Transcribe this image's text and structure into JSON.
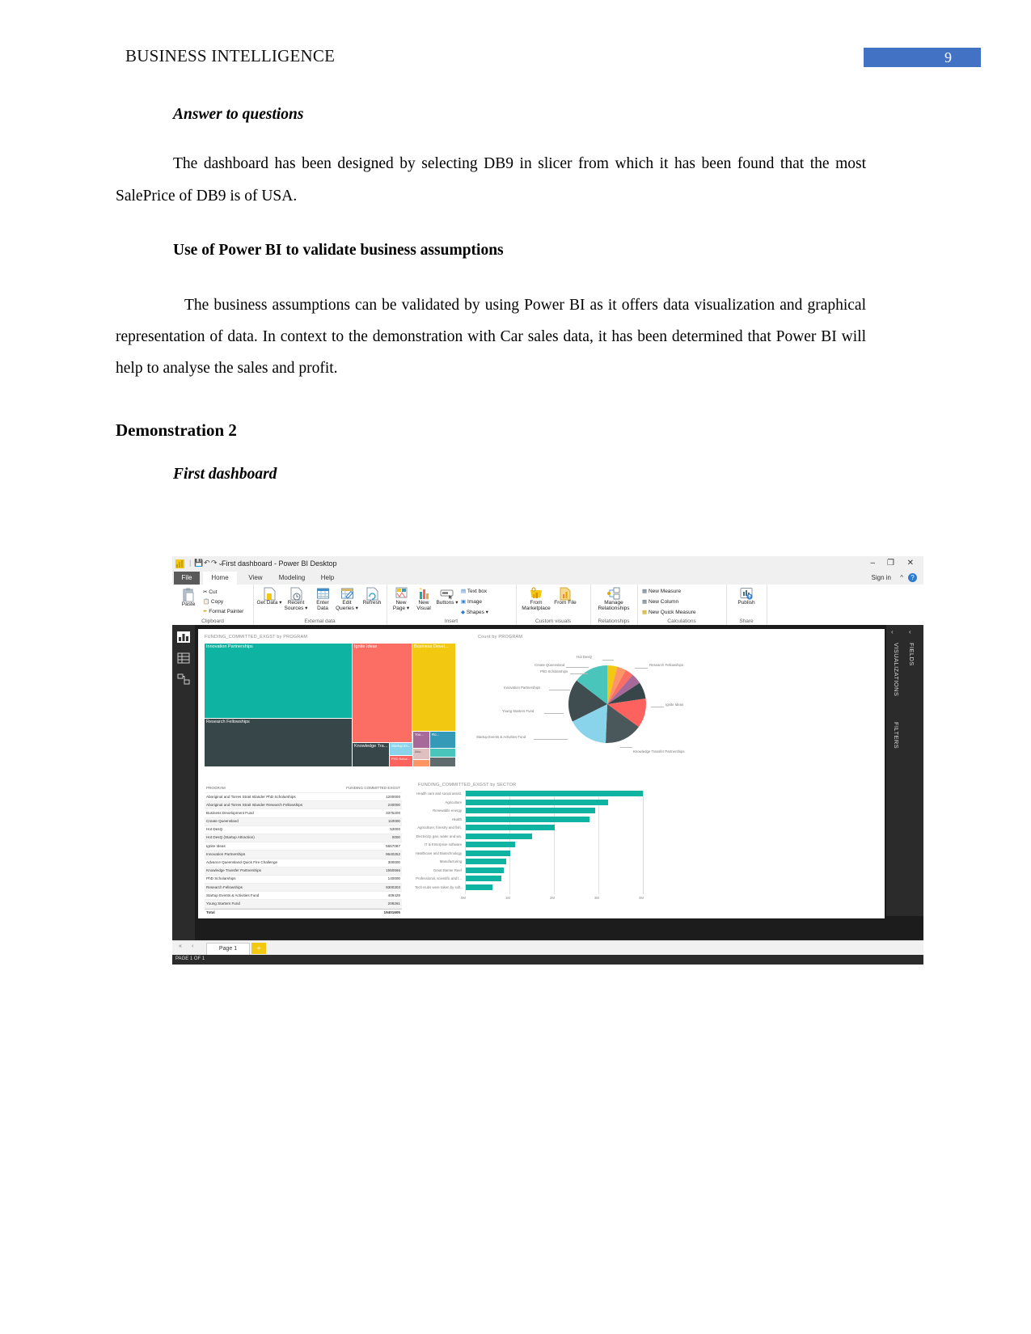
{
  "header": {
    "running_title": "BUSINESS INTELLIGENCE",
    "page_number": "9",
    "badge_color": "#4272c4"
  },
  "document": {
    "heading_answer": "Answer to questions",
    "para_1": "The dashboard has been designed by selecting DB9 in slicer from which it has been found that the most SalePrice of DB9 is of USA.",
    "heading_powerbi": "Use of Power BI to validate business assumptions",
    "para_2": "The business assumptions can be validated by using Power BI as it offers data visualization and graphical representation of data. In context to the demonstration with Car sales data, it has been determined that Power BI will help to analyse the sales and profit.",
    "heading_demo": "Demonstration 2",
    "heading_first_dashboard": "First dashboard"
  },
  "powerbi": {
    "title_bar": {
      "document_title": "First dashboard - Power BI Desktop",
      "qat": [
        "save-icon",
        "undo-icon",
        "redo-icon",
        "dropdown-icon"
      ],
      "window_buttons": [
        "minimize",
        "restore",
        "close"
      ],
      "minimize": "–",
      "restore": "❐",
      "close": "✕"
    },
    "ribbon_tabs": [
      {
        "label": "File",
        "active": false
      },
      {
        "label": "Home",
        "active": true
      },
      {
        "label": "View",
        "active": false
      },
      {
        "label": "Modeling",
        "active": false
      },
      {
        "label": "Help",
        "active": false
      }
    ],
    "sign_in": "Sign in",
    "help_badge": "?",
    "ribbon_groups": [
      {
        "name": "Clipboard",
        "items": [
          "Paste"
        ],
        "small_items": [
          "Cut",
          "Copy",
          "Format Painter"
        ]
      },
      {
        "name": "External data",
        "items": [
          "Get Data ▾",
          "Recent Sources ▾",
          "Enter Data",
          "Edit Queries ▾",
          "Refresh"
        ],
        "small_items": []
      },
      {
        "name": "Insert",
        "items": [
          "New Page ▾",
          "New Visual",
          "Buttons ▾"
        ],
        "small_items": [
          "Text box",
          "Image",
          "Shapes ▾"
        ]
      },
      {
        "name": "Custom visuals",
        "items": [
          "From Marketplace",
          "From File"
        ],
        "small_items": []
      },
      {
        "name": "Relationships",
        "items": [
          "Manage Relationships"
        ],
        "small_items": []
      },
      {
        "name": "Calculations",
        "items": [],
        "small_items": [
          "New Measure",
          "New Column",
          "New Quick Measure"
        ]
      },
      {
        "name": "Share",
        "items": [
          "Publish"
        ],
        "small_items": []
      }
    ],
    "left_rail_icons": [
      "report-view-icon",
      "data-view-icon",
      "model-view-icon"
    ],
    "right_panes": [
      "FIELDS",
      "VISUALIZATIONS",
      "FILTERS"
    ],
    "page_tabs": {
      "tab_label": "Page 1",
      "add_label": "+",
      "status": "PAGE 1 OF 1"
    }
  },
  "chart_data": [
    {
      "type": "treemap",
      "title": "FUNDING_COMMITTED_EXGST by PROGRAM",
      "categories": [
        "Innovation Partnerships",
        "Ignite Ideas",
        "Business Devel...",
        "Research Fellowships",
        "Knowledge Tra...",
        "Startup Ev...",
        "You...",
        "Ro...",
        "PHD Schol...",
        "Abo...",
        "Stu...",
        "Hot..."
      ],
      "values": [
        9640252,
        5657087,
        3375200,
        9300303,
        1550566,
        1000000,
        582000,
        409429,
        1200000,
        240000,
        208261,
        53000
      ],
      "colors": [
        "#0fb3a1",
        "#fc6d64",
        "#f2c811",
        "#374649",
        "#8ad4eb",
        "#fd625e",
        "#a66999",
        "#3599b8",
        "#fe9666",
        "#dfbfbf",
        "#4ac5bb",
        "#5f6b6d"
      ]
    },
    {
      "type": "pie",
      "title": "Count by PROGRAM",
      "labels": [
        "Hot DesQ",
        "Create Queensland",
        "PhD Scholarships",
        "Innovation Partnerships",
        "Young Starters Fund",
        "Startup Events & Activities Fund",
        "Knowledge Transfer Partnerships",
        "Ignite Ideas",
        "Research Fellowships"
      ],
      "values": [
        6,
        4,
        5,
        7,
        9,
        12,
        14,
        18,
        25
      ],
      "colors": [
        "#f2c811",
        "#fd9666",
        "#fc6d64",
        "#a66999",
        "#8ad4eb",
        "#3599b8",
        "#4ac5bb",
        "#fd625e",
        "#374649"
      ]
    },
    {
      "type": "table",
      "columns": [
        "PROGRAM",
        "FUNDING COMMITTED EXGST"
      ],
      "rows": [
        [
          "Aboriginal and Torres Strait Islander PhD Scholarships",
          "1200000"
        ],
        [
          "Aboriginal and Torres Strait Islander Research Fellowships",
          "240000"
        ],
        [
          "Business Development Fund",
          "3375200"
        ],
        [
          "Create Queensland",
          "110000"
        ],
        [
          "Hot DesQ",
          "53000"
        ],
        [
          "Hot DesQ (Startup Attraction)",
          "0000"
        ],
        [
          "Ignite Ideas",
          "5657087"
        ],
        [
          "Innovation Partnerships",
          "9640252"
        ],
        [
          "Advance Queensland Quick Fire Challenge",
          "300000"
        ],
        [
          "Knowledge Transfer Partnerships",
          "1550566"
        ],
        [
          "PhD Scholarships",
          "140000"
        ],
        [
          "Research Fellowships",
          "9300303"
        ],
        [
          "Startup Events & Activities Fund",
          "409429"
        ],
        [
          "Young Starters Fund",
          "208261"
        ],
        [
          "Total",
          "19401605"
        ]
      ]
    },
    {
      "type": "bar",
      "orientation": "horizontal",
      "title": "FUNDING_COMMITTED_EXGST by SECTOR",
      "categories": [
        "Health care and social assist.",
        "Agriculture",
        "Renewable energy",
        "Health",
        "Agriculture, forestry and fish.",
        "Electricity, gas, water and wa.",
        "IT & Enterprise software",
        "Healthcare and Biotechnology",
        "Manufacturing",
        "Great Barrier Reef",
        "Professional, scientific and t...",
        "Tech Hubs were taken by soft..."
      ],
      "values": [
        4.0,
        3.2,
        2.9,
        2.8,
        2.0,
        1.5,
        1.1,
        1.0,
        0.9,
        0.85,
        0.8,
        0.6
      ],
      "xlabel": "",
      "ylabel": "",
      "xticks": [
        "0M",
        "1M",
        "2M",
        "3M",
        "4M"
      ],
      "xlim": [
        0,
        4.4
      ],
      "bar_color": "#0fb3a1"
    }
  ]
}
